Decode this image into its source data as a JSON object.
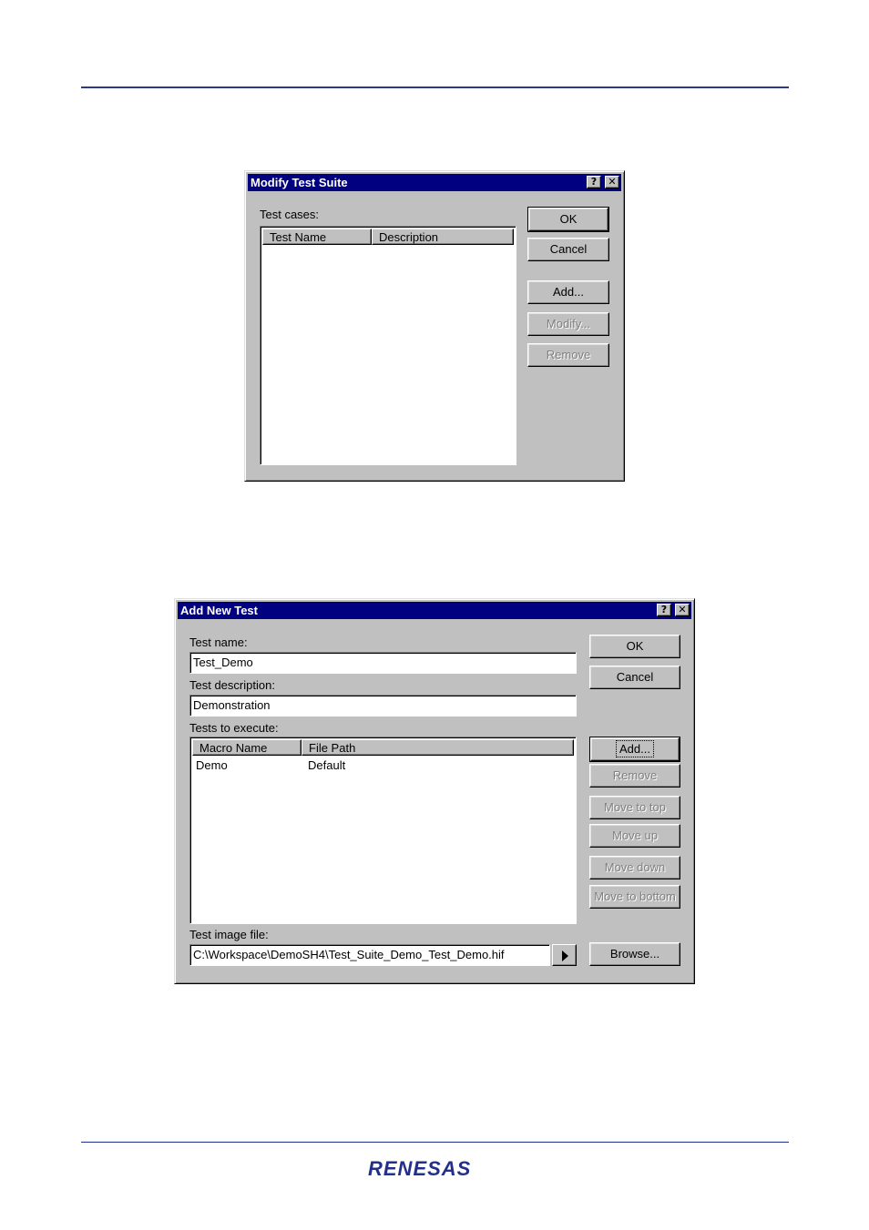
{
  "modify_dialog": {
    "title": "Modify Test Suite",
    "test_cases_label": "Test cases:",
    "columns": [
      "Test Name",
      "Description"
    ],
    "buttons": {
      "ok": "OK",
      "cancel": "Cancel",
      "add": "Add...",
      "modify": "Modify...",
      "remove": "Remove"
    }
  },
  "add_dialog": {
    "title": "Add New Test",
    "test_name_label": "Test name:",
    "test_name_value": "Test_Demo",
    "test_description_label": "Test description:",
    "test_description_value": "Demonstration",
    "tests_to_execute_label": "Tests to execute:",
    "columns": [
      "Macro Name",
      "File Path"
    ],
    "rows": [
      {
        "macro_name": "Demo",
        "file_path": "Default"
      }
    ],
    "test_image_file_label": "Test image file:",
    "test_image_file_value": "C:\\Workspace\\DemoSH4\\Test_Suite_Demo_Test_Demo.hif",
    "buttons": {
      "ok": "OK",
      "cancel": "Cancel",
      "add": "Add...",
      "remove": "Remove",
      "move_to_top": "Move to top",
      "move_up": "Move up",
      "move_down": "Move down",
      "move_to_bottom": "Move to bottom",
      "browse": "Browse..."
    }
  },
  "title_buttons": {
    "help": "?",
    "close": "✕"
  },
  "footer": {
    "logo_text": "RENESAS"
  }
}
